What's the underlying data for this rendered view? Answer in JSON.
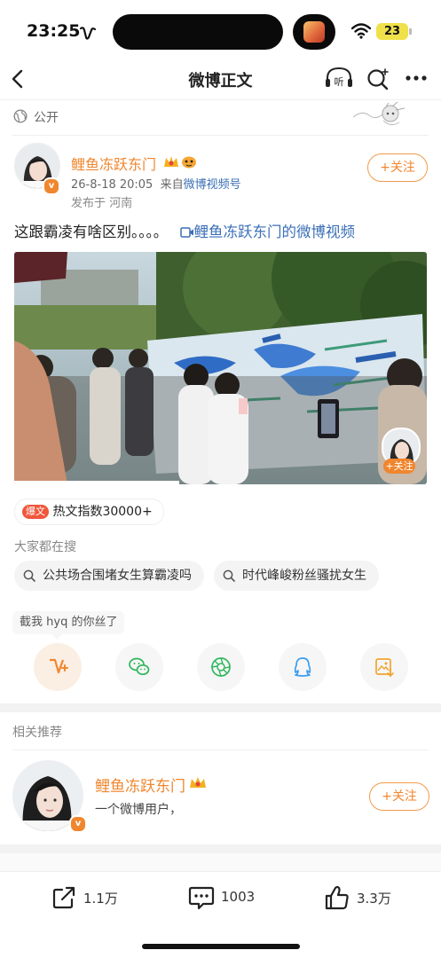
{
  "status_bar": {
    "time": "23:25",
    "battery": "23"
  },
  "nav": {
    "title": "微博正文"
  },
  "visibility": {
    "label": "公开"
  },
  "post": {
    "author": "鲤鱼冻跃东门",
    "date": "26-8-18 20:05",
    "source_prefix": "来自",
    "source": "微博视频号",
    "location": "发布于 河南",
    "follow_label": "+关注",
    "text": "这跟霸凌有啥区别。。。。",
    "video_link": "鲤鱼冻跃东门的微博视频",
    "video_follow": "+关注"
  },
  "hot": {
    "badge": "爆文",
    "text": "热文指数30000+"
  },
  "searches": {
    "title": "大家都在搜",
    "items": [
      "公共场合围堵女生算霸凌吗",
      "时代峰峻粉丝骚扰女生"
    ]
  },
  "share": {
    "tooltip": "截我 hyq 的你丝了"
  },
  "related": {
    "title": "相关推荐",
    "name": "鲤鱼冻跃东门",
    "desc": "一个微博用户，",
    "follow_label": "+关注"
  },
  "bottom_bar": {
    "share_count": "1.1万",
    "comment_count": "1003",
    "like_count": "3.3万"
  },
  "colors": {
    "accent": "#f0862e",
    "link": "#3b6fb6",
    "follow_border": "#f29a4a",
    "hot_badge": "#f0573b"
  }
}
